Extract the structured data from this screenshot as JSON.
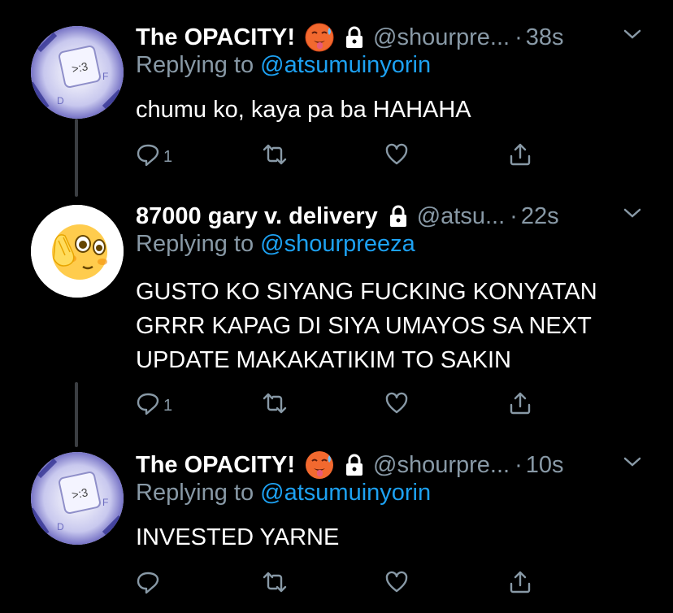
{
  "tweets": [
    {
      "display_name": "The OPACITY!",
      "handle": "@shourpre...",
      "time": "38s",
      "replying_prefix": "Replying to ",
      "replying_to": "@atsumuinyorin",
      "text": "chumu ko, kaya pa ba HAHAHA",
      "reply_count": "1",
      "avatar_icon": "keyboard-key-avatar",
      "name_emoji": "hot-face-emoji"
    },
    {
      "display_name": "87000 gary v. delivery",
      "handle": "@atsu...",
      "time": "22s",
      "replying_prefix": "Replying to ",
      "replying_to": "@shourpreeza",
      "text": "GUSTO KO SIYANG FUCKING KONYATAN\nGRRR KAPAG DI SIYA UMAYOS SA NEXT\nUPDATE MAKAKATIKIM TO SAKIN",
      "reply_count": "1",
      "avatar_icon": "flushed-face-emoji-avatar"
    },
    {
      "display_name": "The OPACITY!",
      "handle": "@shourpre...",
      "time": "10s",
      "replying_prefix": "Replying to ",
      "replying_to": "@atsumuinyorin",
      "text": "INVESTED YARNE",
      "reply_count": "",
      "avatar_icon": "keyboard-key-avatar",
      "name_emoji": "hot-face-emoji"
    }
  ],
  "separator": "·",
  "avatar_key_label": ">:3",
  "colors": {
    "background": "#000000",
    "muted": "#8899a6",
    "link": "#1da1f2",
    "thread_line": "#3b3e42"
  }
}
